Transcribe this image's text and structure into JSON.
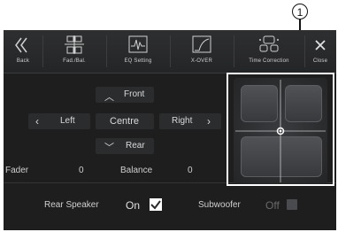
{
  "callout": "1",
  "toolbar": {
    "back": "Back",
    "fad_bal": "Fad./Bal.",
    "eq_setting": "EQ Setting",
    "xover": "X-OVER",
    "time_correction": "Time Correction",
    "close": "Close"
  },
  "controls": {
    "front": "Front",
    "left": "Left",
    "centre": "Centre",
    "right": "Right",
    "rear": "Rear"
  },
  "fader": {
    "label": "Fader",
    "value": "0"
  },
  "balance": {
    "label": "Balance",
    "value": "0"
  },
  "rear_speaker": {
    "label": "Rear Speaker",
    "state": "On"
  },
  "subwoofer": {
    "label": "Subwoofer",
    "state": "Off"
  }
}
